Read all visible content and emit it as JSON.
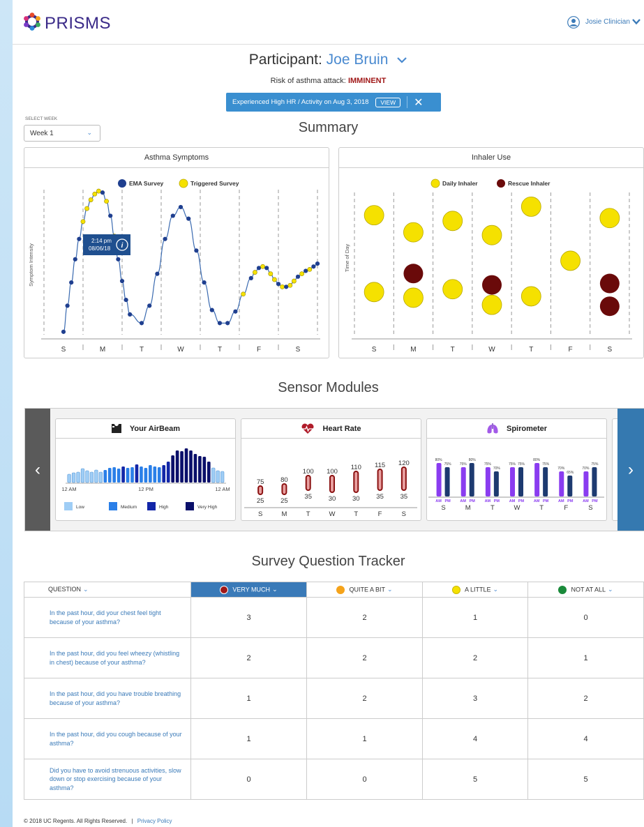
{
  "app": {
    "name": "PRISMS"
  },
  "user": {
    "name": "Josie Clinician"
  },
  "participant": {
    "prefix": "Participant:",
    "name": "Joe Bruin"
  },
  "risk": {
    "label": "Risk of asthma attack:",
    "value": "IMMINENT",
    "color": "#a01818"
  },
  "alert": {
    "text": "Experienced High HR / Activity on Aug 3, 2018",
    "view_label": "VIEW"
  },
  "week_select": {
    "label": "SELECT WEEK",
    "value": "Week 1"
  },
  "summary": {
    "title": "Summary",
    "days": [
      "S",
      "M",
      "T",
      "W",
      "T",
      "F",
      "S"
    ],
    "asthma": {
      "title": "Asthma Symptoms",
      "ylabel": "Symptom Intensity",
      "legend": [
        "EMA Survey",
        "Triggered Survey"
      ],
      "tooltip": {
        "time": "2:14 pm",
        "date": "08/06/18"
      },
      "series_colors": {
        "ema": "#1f3f8f",
        "triggered": "#f5e100"
      },
      "points": [
        {
          "x": 0.0,
          "y": 0.02,
          "t": "e"
        },
        {
          "x": 0.1,
          "y": 0.2,
          "t": "e"
        },
        {
          "x": 0.2,
          "y": 0.36,
          "t": "e"
        },
        {
          "x": 0.3,
          "y": 0.52,
          "t": "e"
        },
        {
          "x": 0.4,
          "y": 0.66,
          "t": "e"
        },
        {
          "x": 0.5,
          "y": 0.78,
          "t": "t"
        },
        {
          "x": 0.6,
          "y": 0.87,
          "t": "t"
        },
        {
          "x": 0.7,
          "y": 0.93,
          "t": "t"
        },
        {
          "x": 0.8,
          "y": 0.97,
          "t": "t"
        },
        {
          "x": 0.9,
          "y": 0.99,
          "t": "t"
        },
        {
          "x": 1.0,
          "y": 0.98,
          "t": "e"
        },
        {
          "x": 1.1,
          "y": 0.92,
          "t": "t"
        },
        {
          "x": 1.2,
          "y": 0.82,
          "t": "e"
        },
        {
          "x": 1.3,
          "y": 0.68,
          "t": "t"
        },
        {
          "x": 1.4,
          "y": 0.52,
          "t": "e"
        },
        {
          "x": 1.5,
          "y": 0.37,
          "t": "e"
        },
        {
          "x": 1.6,
          "y": 0.24,
          "t": "e"
        },
        {
          "x": 1.7,
          "y": 0.14,
          "t": "e"
        },
        {
          "x": 2.0,
          "y": 0.08,
          "t": "e"
        },
        {
          "x": 2.2,
          "y": 0.2,
          "t": "e"
        },
        {
          "x": 2.4,
          "y": 0.42,
          "t": "e"
        },
        {
          "x": 2.6,
          "y": 0.66,
          "t": "e"
        },
        {
          "x": 2.8,
          "y": 0.82,
          "t": "e"
        },
        {
          "x": 3.0,
          "y": 0.88,
          "t": "e"
        },
        {
          "x": 3.2,
          "y": 0.8,
          "t": "e"
        },
        {
          "x": 3.4,
          "y": 0.58,
          "t": "e"
        },
        {
          "x": 3.6,
          "y": 0.36,
          "t": "e"
        },
        {
          "x": 3.8,
          "y": 0.17,
          "t": "e"
        },
        {
          "x": 4.0,
          "y": 0.08,
          "t": "e"
        },
        {
          "x": 4.2,
          "y": 0.08,
          "t": "e"
        },
        {
          "x": 4.4,
          "y": 0.16,
          "t": "e"
        },
        {
          "x": 4.6,
          "y": 0.28,
          "t": "t"
        },
        {
          "x": 4.8,
          "y": 0.39,
          "t": "e"
        },
        {
          "x": 4.9,
          "y": 0.43,
          "t": "t"
        },
        {
          "x": 5.0,
          "y": 0.46,
          "t": "e"
        },
        {
          "x": 5.1,
          "y": 0.47,
          "t": "t"
        },
        {
          "x": 5.2,
          "y": 0.46,
          "t": "e"
        },
        {
          "x": 5.3,
          "y": 0.42,
          "t": "t"
        },
        {
          "x": 5.4,
          "y": 0.38,
          "t": "t"
        },
        {
          "x": 5.5,
          "y": 0.35,
          "t": "e"
        },
        {
          "x": 5.6,
          "y": 0.33,
          "t": "t"
        },
        {
          "x": 5.7,
          "y": 0.33,
          "t": "e"
        },
        {
          "x": 5.8,
          "y": 0.34,
          "t": "t"
        },
        {
          "x": 5.9,
          "y": 0.37,
          "t": "t"
        },
        {
          "x": 6.0,
          "y": 0.4,
          "t": "e"
        },
        {
          "x": 6.1,
          "y": 0.42,
          "t": "t"
        },
        {
          "x": 6.2,
          "y": 0.44,
          "t": "e"
        },
        {
          "x": 6.3,
          "y": 0.45,
          "t": "t"
        },
        {
          "x": 6.4,
          "y": 0.47,
          "t": "e"
        },
        {
          "x": 6.5,
          "y": 0.49,
          "t": "e"
        }
      ]
    },
    "inhaler": {
      "title": "Inhaler Use",
      "ylabel": "Time of Day",
      "legend": [
        "Daily Inhaler",
        "Rescue Inhaler"
      ],
      "colors": {
        "daily": "#f5e100",
        "rescue": "#6a0a0a"
      },
      "doses": [
        {
          "day": 0,
          "time": 0.84,
          "type": "daily"
        },
        {
          "day": 0,
          "time": 0.3,
          "type": "daily"
        },
        {
          "day": 1,
          "time": 0.72,
          "type": "daily"
        },
        {
          "day": 1,
          "time": 0.43,
          "type": "rescue"
        },
        {
          "day": 1,
          "time": 0.26,
          "type": "daily"
        },
        {
          "day": 2,
          "time": 0.8,
          "type": "daily"
        },
        {
          "day": 2,
          "time": 0.32,
          "type": "daily"
        },
        {
          "day": 3,
          "time": 0.7,
          "type": "daily"
        },
        {
          "day": 3,
          "time": 0.35,
          "type": "rescue"
        },
        {
          "day": 3,
          "time": 0.21,
          "type": "daily"
        },
        {
          "day": 4,
          "time": 0.9,
          "type": "daily"
        },
        {
          "day": 4,
          "time": 0.27,
          "type": "daily"
        },
        {
          "day": 5,
          "time": 0.52,
          "type": "daily"
        },
        {
          "day": 6,
          "time": 0.82,
          "type": "daily"
        },
        {
          "day": 6,
          "time": 0.36,
          "type": "rescue"
        },
        {
          "day": 6,
          "time": 0.2,
          "type": "rescue"
        }
      ]
    }
  },
  "sensors": {
    "title": "Sensor Modules",
    "airbeam": {
      "title": "Your AirBeam",
      "x_labels": [
        "12 AM",
        "12 PM",
        "12 AM"
      ],
      "levels": [
        1,
        1,
        1,
        1,
        1,
        1,
        1,
        1,
        2,
        2,
        2,
        2,
        3,
        2,
        2,
        3,
        2,
        2,
        2,
        2,
        2,
        3,
        3,
        4,
        4,
        4,
        4,
        4,
        4,
        4,
        4,
        4,
        1,
        1,
        1
      ],
      "heights": [
        0.24,
        0.28,
        0.3,
        0.4,
        0.34,
        0.3,
        0.36,
        0.3,
        0.36,
        0.42,
        0.44,
        0.4,
        0.46,
        0.42,
        0.44,
        0.52,
        0.46,
        0.42,
        0.5,
        0.46,
        0.44,
        0.5,
        0.6,
        0.78,
        0.92,
        0.9,
        0.98,
        0.92,
        0.82,
        0.76,
        0.74,
        0.6,
        0.42,
        0.34,
        0.32
      ],
      "legend": [
        "Low",
        "Medium",
        "High",
        "Very High"
      ],
      "legend_colors": [
        "#9fcdf5",
        "#2a7fe8",
        "#1226a8",
        "#0a0f6a"
      ]
    },
    "heart_rate": {
      "title": "Heart Rate",
      "days": [
        "S",
        "M",
        "T",
        "W",
        "T",
        "F",
        "S"
      ],
      "high": [
        "75",
        "80",
        "100",
        "100",
        "110",
        "115",
        "120"
      ],
      "low": [
        "25",
        "25",
        "35",
        "30",
        "30",
        "35",
        "35"
      ],
      "high_values": [
        75,
        80,
        100,
        100,
        110,
        115,
        120
      ],
      "low_values": [
        25,
        25,
        35,
        30,
        30,
        35,
        35
      ]
    },
    "spirometer": {
      "title": "Spirometer",
      "days": [
        "S",
        "M",
        "T",
        "W",
        "T",
        "F",
        "S"
      ],
      "am_pm": [
        "AM",
        "PM"
      ],
      "am_labels": [
        "80%",
        "75%",
        "75%",
        "75%",
        "80%",
        "70%",
        "70%"
      ],
      "pm_labels": [
        "75%",
        "80%",
        "70%",
        "75%",
        "75%",
        "65%",
        "75%"
      ],
      "am_values": [
        80,
        75,
        75,
        75,
        80,
        70,
        70
      ],
      "pm_values": [
        75,
        80,
        70,
        75,
        75,
        65,
        75
      ],
      "colors": {
        "am": "#8a3cf0",
        "pm": "#1d3a70"
      }
    }
  },
  "tracker": {
    "title": "Survey Question Tracker",
    "question_header": "QUESTION",
    "columns": [
      {
        "label": "VERY MUCH",
        "color": "#a01818"
      },
      {
        "label": "QUITE A BIT",
        "color": "#f5a31a"
      },
      {
        "label": "A LITTLE",
        "color": "#f5e100"
      },
      {
        "label": "NOT AT ALL",
        "color": "#1a8a3a"
      }
    ],
    "rows": [
      {
        "q": "In the past hour, did your chest feel tight because of your asthma?",
        "v": [
          "3",
          "2",
          "1",
          "0"
        ]
      },
      {
        "q": "In the past hour, did you feel wheezy (whistling in chest) because of your asthma?",
        "v": [
          "2",
          "2",
          "2",
          "1"
        ]
      },
      {
        "q": "In the past hour, did you have trouble breathing because of your asthma?",
        "v": [
          "1",
          "2",
          "3",
          "2"
        ]
      },
      {
        "q": "In the past hour, did you cough because of your asthma?",
        "v": [
          "1",
          "1",
          "4",
          "4"
        ]
      },
      {
        "q": "Did you have to avoid strenuous activities, slow down or stop exercising because of your asthma?",
        "v": [
          "0",
          "0",
          "5",
          "5"
        ]
      }
    ]
  },
  "footer": {
    "copyright": "© 2018 UC Regents. All Rights Reserved.",
    "separator": "|",
    "privacy": "Privacy Policy"
  }
}
